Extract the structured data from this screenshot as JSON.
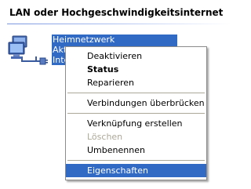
{
  "group": {
    "header": "LAN oder Hochgeschwindigkeitsinternet"
  },
  "connection": {
    "name": "Heimnetzwerk",
    "status_fragment": "Aktiv",
    "device_fragment": "Intel("
  },
  "menu": {
    "items": [
      {
        "label": "Deaktivieren"
      },
      {
        "label": "Status"
      },
      {
        "label": "Reparieren"
      },
      {
        "label": "Verbindungen überbrücken"
      },
      {
        "label": "Verknüpfung erstellen"
      },
      {
        "label": "Löschen"
      },
      {
        "label": "Umbenennen"
      },
      {
        "label": "Eigenschaften"
      }
    ]
  },
  "colors": {
    "selection": "#316ac5",
    "disabled_text": "#aca899",
    "header_rule": "#7a96df"
  },
  "icons": {
    "connection": "network-connection-icon"
  }
}
